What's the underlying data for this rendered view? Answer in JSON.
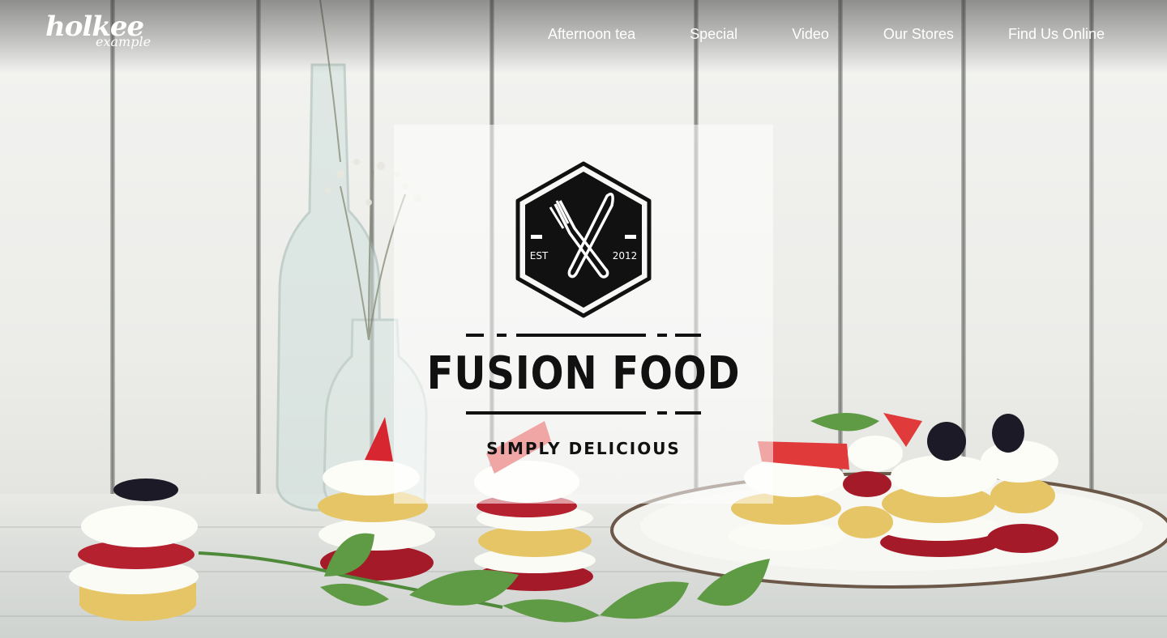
{
  "logo": {
    "main": "holkee",
    "sub": "example"
  },
  "nav": {
    "items": [
      {
        "label": "Afternoon tea"
      },
      {
        "label": "Special"
      },
      {
        "label": "Video"
      },
      {
        "label": "Our Stores"
      },
      {
        "label": "Find Us Online"
      }
    ]
  },
  "hero": {
    "emblem": {
      "left_text": "EST",
      "right_text": "2012",
      "icon": "fork-knife-icon"
    },
    "title": "FUSION FOOD",
    "tagline": "SIMPLY DELICIOUS"
  },
  "colors": {
    "nav_text": "#ffffff",
    "brand_text": "#111111",
    "card_bg": "rgba(255,255,255,0.55)",
    "berry_red": "#b5212e"
  }
}
